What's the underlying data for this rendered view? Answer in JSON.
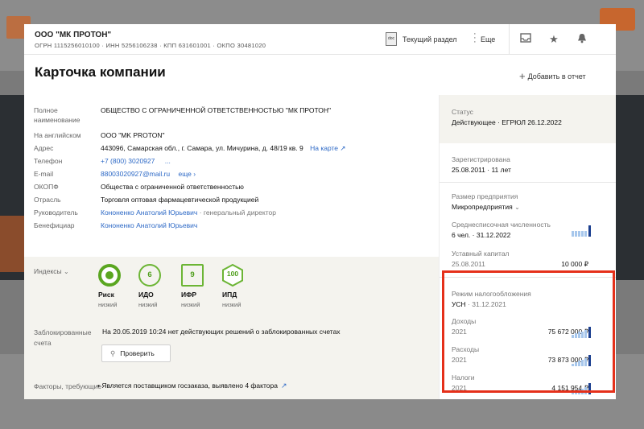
{
  "company": {
    "short_name": "ООО \"МК ПРОТОН\"",
    "ids_line": "ОГРН 1115256010100 · ИНН 5256106238 · КПП 631601001 · ОКПО 30481020"
  },
  "toolbar": {
    "doc_label": "doc",
    "section_label": "Текущий раздел",
    "more_label": "Еще"
  },
  "header": {
    "title": "Карточка компании",
    "add_report": "Добавить в отчет"
  },
  "details": {
    "full_name_label": "Полное наименование",
    "full_name": "ОБЩЕСТВО С ОГРАНИЧЕННОЙ ОТВЕТСТВЕННОСТЬЮ \"МК ПРОТОН\"",
    "english_label": "На английском",
    "english": "OOO \"MK PROTON\"",
    "address_label": "Адрес",
    "address": "443096, Самарская обл., г. Самара, ул. Мичурина, д. 48/19 кв. 9",
    "map_link": "На карте",
    "phone_label": "Телефон",
    "phone": "+7 (800) 3020927",
    "phone_more": "...",
    "email_label": "E-mail",
    "email": "88003020927@mail.ru",
    "email_more": "еще",
    "okopf_label": "ОКОПФ",
    "okopf": "Общества с ограниченной ответственностью",
    "industry_label": "Отрасль",
    "industry": "Торговля оптовая фармацевтической продукцией",
    "head_label": "Руководитель",
    "head_name": "Кононенко Анатолий Юрьевич",
    "head_role": "· генеральный директор",
    "beneficiary_label": "Бенефициар",
    "beneficiary": "Кононенко Анатолий Юрьевич"
  },
  "indices": {
    "label": "Индексы",
    "items": [
      {
        "name": "Риск",
        "value": "",
        "level": "низкий"
      },
      {
        "name": "ИДО",
        "value": "6",
        "level": "низкий"
      },
      {
        "name": "ИФР",
        "value": "9",
        "level": "низкий"
      },
      {
        "name": "ИПД",
        "value": "100",
        "level": "низкий"
      }
    ]
  },
  "blocked": {
    "label": "Заблокированные счета",
    "text": "На 20.05.2019 10:24 нет действующих решений о заблокированных счетах",
    "button": "Проверить"
  },
  "factors": {
    "label": "Факторы, требующие",
    "text": "• Является поставщиком госзаказа, выявлено 4 фактора"
  },
  "side": {
    "status_label": "Статус",
    "status_value": "Действующее · ЕГРЮЛ 26.12.2022",
    "registered_label": "Зарегистрирована",
    "registered_value": "25.08.2011 · 11 лет",
    "size_label": "Размер предприятия",
    "size_value": "Микропредприятия",
    "headcount_label": "Среднесписочная численность",
    "headcount_value": "6 чел. · 31.12.2022",
    "capital_label": "Уставный капитал",
    "capital_date": "25.08.2011",
    "capital_value": "10 000 ₽",
    "tax_label": "Режим налогообложения",
    "tax_value": "УСН",
    "tax_date": "· 31.12.2021",
    "income_label": "Доходы",
    "income_year": "2021",
    "income_value": "75 672 000 ₽",
    "expenses_label": "Расходы",
    "expenses_year": "2021",
    "expenses_value": "73 873 000 ₽",
    "taxes_label": "Налоги",
    "taxes_year": "2021",
    "taxes_value": "4 151 954 ₽"
  },
  "colors": {
    "accent_link": "#2d69c6",
    "index_green": "#5aa620",
    "highlight_red": "#e5301a",
    "bar_light": "#a7c7ec",
    "bar_dark": "#1b3f8f"
  }
}
